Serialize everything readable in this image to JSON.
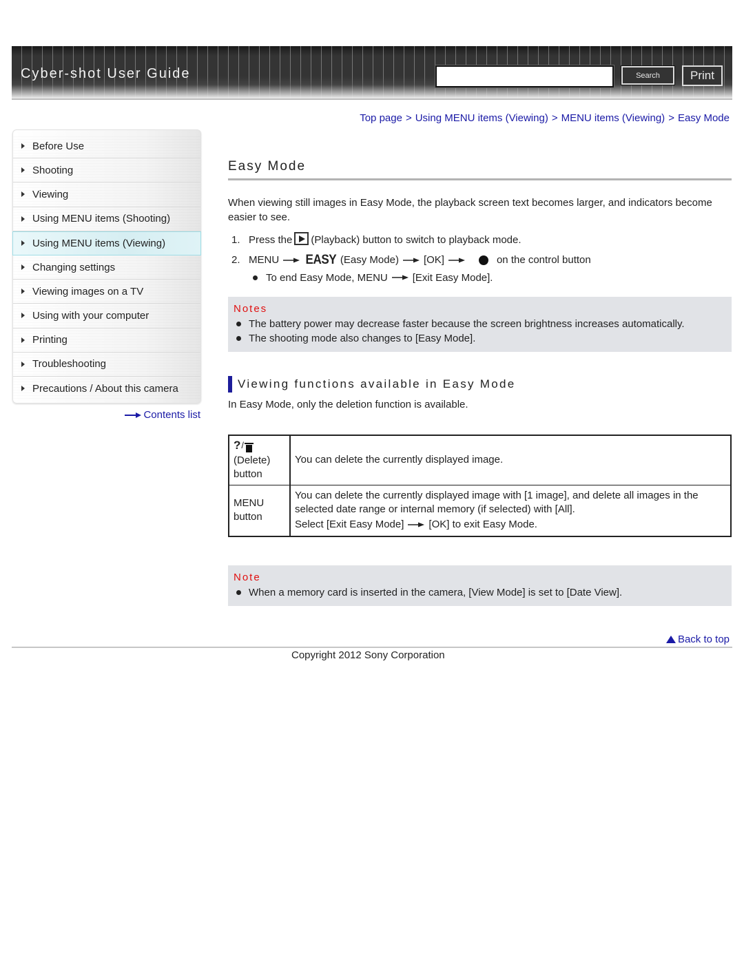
{
  "header": {
    "title": "Cyber-shot User Guide",
    "search_placeholder": "",
    "search_value": "",
    "search_label": "Search",
    "print_label": "Print"
  },
  "breadcrumb": [
    {
      "label": "Top page"
    },
    {
      "label": "Using MENU items (Viewing)"
    },
    {
      "label": "MENU items (Viewing)"
    },
    {
      "label": "Easy Mode"
    }
  ],
  "breadcrumb_separator": ">",
  "sidebar": {
    "items": [
      {
        "label": "Before Use",
        "active": false
      },
      {
        "label": "Shooting",
        "active": false
      },
      {
        "label": "Viewing",
        "active": false
      },
      {
        "label": "Using MENU items (Shooting)",
        "active": false
      },
      {
        "label": "Using MENU items (Viewing)",
        "active": true
      },
      {
        "label": "Changing settings",
        "active": false
      },
      {
        "label": "Viewing images on a TV",
        "active": false
      },
      {
        "label": "Using with your computer",
        "active": false
      },
      {
        "label": "Printing",
        "active": false
      },
      {
        "label": "Troubleshooting",
        "active": false
      },
      {
        "label": "Precautions / About this camera",
        "active": false
      }
    ],
    "contents_link": "Contents list"
  },
  "main": {
    "title": "Easy Mode",
    "intro": "When viewing still images in Easy Mode, the playback screen text becomes larger, and indicators become easier to see.",
    "steps": {
      "s1": {
        "num": "1.",
        "pre": "Press the",
        "icon": "playback-icon",
        "post": "(Playback) button to switch to playback mode."
      },
      "s2": {
        "num": "2.",
        "menu": "MENU",
        "easy_icon": "EASY",
        "easy_label": "(Easy Mode)",
        "ok": "[OK]",
        "dot_icon": "center-button-icon",
        "post": "on the control button"
      },
      "sub": {
        "pre": "To end Easy Mode, MENU",
        "post": "[Exit Easy Mode]."
      }
    },
    "notes": {
      "title": "Notes",
      "items": [
        "The battery power may decrease faster because the screen brightness increases automatically.",
        "The shooting mode also changes to [Easy Mode]."
      ]
    },
    "section": {
      "heading": "Viewing functions available in Easy Mode",
      "intro": "In Easy Mode, only the deletion function is available."
    },
    "table": {
      "rows": [
        {
          "label_icons": "?/trash",
          "label_line1": "(Delete)",
          "label_line2": "button",
          "desc1": "You can delete the currently displayed image."
        },
        {
          "label_line1": "MENU",
          "label_line2": "button",
          "desc1": "You can delete the currently displayed image with [1 image], and delete all images in the selected date range or internal memory (if selected) with [All].",
          "desc2_pre": "Select [Exit Easy Mode]",
          "desc2_post": "[OK] to exit Easy Mode."
        }
      ]
    },
    "note2": {
      "title": "Note",
      "items": [
        "When a memory card is inserted in the camera, [View Mode] is set to [Date View]."
      ]
    }
  },
  "footer": {
    "back_to_top": "Back to top",
    "copyright": "Copyright 2012 Sony Corporation"
  },
  "colors": {
    "link": "#1a1aa6",
    "notes_title": "#e01010",
    "section_bar": "#1d1d9a",
    "notes_bg": "#e1e3e7"
  }
}
